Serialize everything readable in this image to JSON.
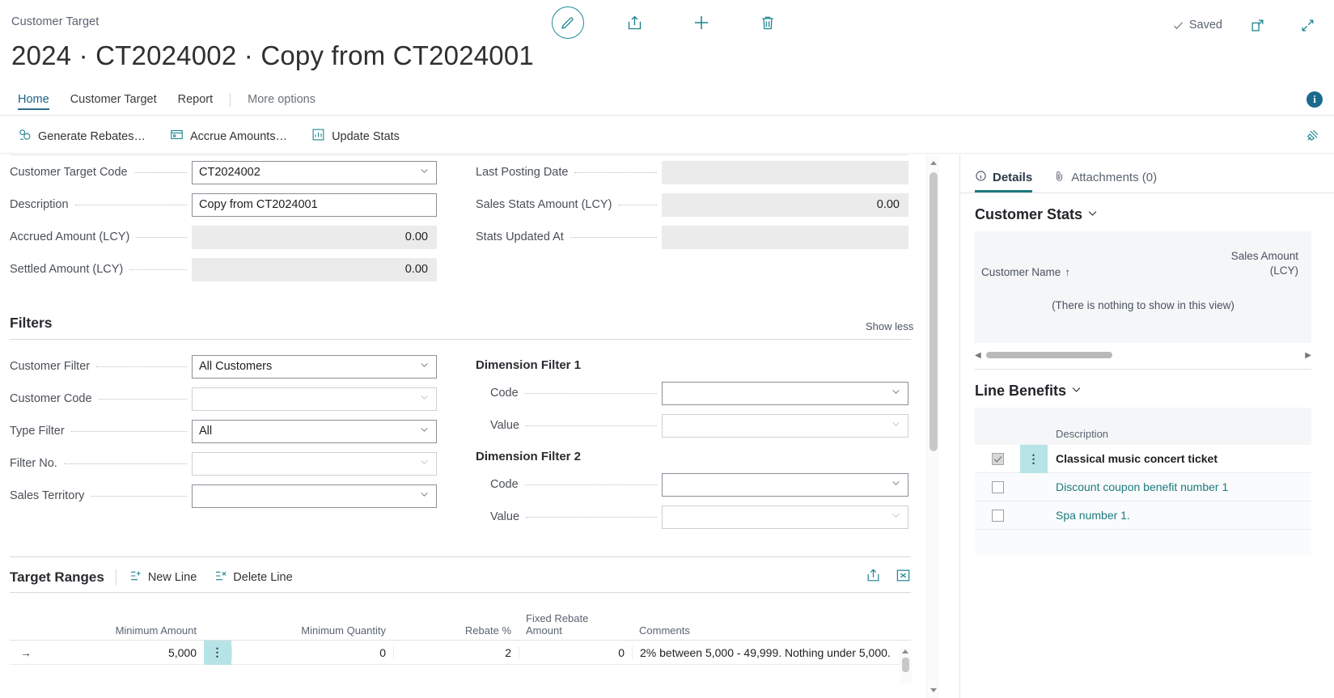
{
  "breadcrumb": "Customer Target",
  "page_title": "2024 · CT2024002 · Copy from CT2024001",
  "status": {
    "saved_label": "Saved"
  },
  "topbar_icons": {
    "edit": "pencil-icon",
    "share": "share-icon",
    "new": "plus-icon",
    "delete": "trash-icon",
    "open_new_window": "open-in-new-window-icon",
    "collapse": "collapse-icon"
  },
  "ribbon": {
    "tabs": [
      {
        "label": "Home",
        "active": true
      },
      {
        "label": "Customer Target",
        "active": false
      },
      {
        "label": "Report",
        "active": false
      }
    ],
    "more_options": "More options",
    "info_badge": "i"
  },
  "actions": [
    {
      "label": "Generate Rebates…",
      "icon": "generate-rebates-icon"
    },
    {
      "label": "Accrue Amounts…",
      "icon": "accrue-amounts-icon"
    },
    {
      "label": "Update Stats",
      "icon": "update-stats-icon"
    }
  ],
  "general": {
    "left": [
      {
        "label": "Customer Target Code",
        "value": "CT2024002",
        "style": "box",
        "dropdown": true
      },
      {
        "label": "Description",
        "value": "Copy from CT2024001",
        "style": "box",
        "dropdown": false
      },
      {
        "label": "Accrued Amount (LCY)",
        "value": "0.00",
        "style": "flat",
        "numeric": true
      },
      {
        "label": "Settled Amount (LCY)",
        "value": "0.00",
        "style": "flat",
        "numeric": true
      }
    ],
    "right": [
      {
        "label": "Last Posting Date",
        "value": "",
        "style": "flat"
      },
      {
        "label": "Sales Stats Amount (LCY)",
        "value": "0.00",
        "style": "flat",
        "numeric": true
      },
      {
        "label": "Stats Updated At",
        "value": "",
        "style": "flat"
      }
    ]
  },
  "filters": {
    "title": "Filters",
    "show_less": "Show less",
    "left": [
      {
        "label": "Customer Filter",
        "value": "All Customers",
        "style": "box",
        "dropdown": true,
        "dim": false
      },
      {
        "label": "Customer Code",
        "value": "",
        "style": "ghost",
        "dropdown": true,
        "dim": true
      },
      {
        "label": "Type Filter",
        "value": "All",
        "style": "box",
        "dropdown": true,
        "dim": false
      },
      {
        "label": "Filter No.",
        "value": "",
        "style": "ghost",
        "dropdown": true,
        "dim": true
      },
      {
        "label": "Sales Territory",
        "value": "",
        "style": "box",
        "dropdown": true,
        "dim": false
      }
    ],
    "dimension_filter_1": {
      "title": "Dimension Filter 1",
      "rows": [
        {
          "label": "Code",
          "value": "",
          "style": "box",
          "dropdown": true,
          "dim": false
        },
        {
          "label": "Value",
          "value": "",
          "style": "ghost",
          "dropdown": true,
          "dim": true
        }
      ]
    },
    "dimension_filter_2": {
      "title": "Dimension Filter 2",
      "rows": [
        {
          "label": "Code",
          "value": "",
          "style": "box",
          "dropdown": true,
          "dim": false
        },
        {
          "label": "Value",
          "value": "",
          "style": "ghost",
          "dropdown": true,
          "dim": true
        }
      ]
    }
  },
  "target_ranges": {
    "title": "Target Ranges",
    "new_line": "New Line",
    "delete_line": "Delete Line",
    "share_icon": "share-icon",
    "expand_icon": "open-in-excel-icon",
    "columns": [
      "Minimum Amount",
      "Minimum Quantity",
      "Rebate %",
      "Fixed Rebate Amount",
      "Comments"
    ],
    "rows": [
      {
        "row_indicator": "→",
        "minimum_amount": "5,000",
        "minimum_quantity": "0",
        "rebate_pct": "2",
        "fixed_rebate_amount": "0",
        "comments": "2% between 5,000 - 49,999. Nothing under 5,000."
      }
    ]
  },
  "factbox": {
    "tabs": [
      {
        "label": "Details",
        "icon": "info-icon",
        "active": true
      },
      {
        "label": "Attachments (0)",
        "icon": "paperclip-icon",
        "active": false
      }
    ],
    "customer_stats": {
      "title": "Customer Stats",
      "col_name": "Customer Name",
      "sort_arrow": "↑",
      "col_amount_line1": "Sales Amount",
      "col_amount_line2": "(LCY)",
      "empty_text": "(There is nothing to show in this view)"
    },
    "line_benefits": {
      "title": "Line Benefits",
      "column": "Description",
      "rows": [
        {
          "checked": true,
          "description": "Classical music concert ticket",
          "selected": true
        },
        {
          "checked": false,
          "description": "Discount coupon benefit number 1",
          "selected": false
        },
        {
          "checked": false,
          "description": "Spa number 1.",
          "selected": false
        }
      ]
    }
  },
  "colors": {
    "accent": "#17808b",
    "tab_active": "#2d6b8f",
    "selection": "#b6e3e6",
    "link": "#1c7a7e"
  }
}
